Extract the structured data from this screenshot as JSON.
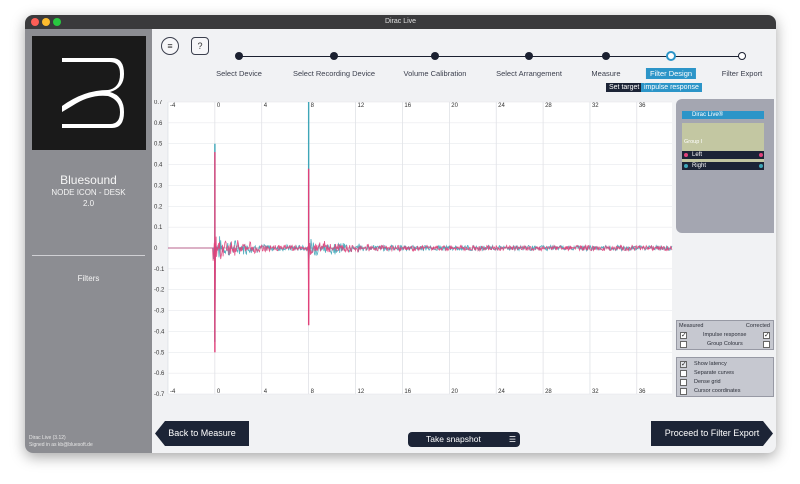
{
  "window": {
    "title": "Dirac Live"
  },
  "device": {
    "brand": "Bluesound",
    "model": "NODE ICON - DESK",
    "version": "2.0",
    "section": "Filters"
  },
  "footer": {
    "version": "Dirac Live (3.12)",
    "signed_in": "Signed in as kb@bluesoft.de"
  },
  "header": {
    "menu_icon": "hamburger-icon",
    "help_label": "?"
  },
  "steps": [
    {
      "label": "Select Device",
      "state": "done"
    },
    {
      "label": "Select Recording Device",
      "state": "done"
    },
    {
      "label": "Volume Calibration",
      "state": "done"
    },
    {
      "label": "Select Arrangement",
      "state": "done"
    },
    {
      "label": "Measure",
      "state": "done"
    },
    {
      "label": "Filter Design",
      "state": "active"
    },
    {
      "label": "Filter Export",
      "state": "pending"
    }
  ],
  "tabs": {
    "target": "Set target",
    "impulse": "impulse response"
  },
  "right_panel": {
    "group_title": "Dirac Live®",
    "group_label": "Group I",
    "channels": [
      {
        "name": "Left",
        "color": "#e0417a"
      },
      {
        "name": "Right",
        "color": "#3fa6b8"
      }
    ]
  },
  "options": {
    "measured": "Measured",
    "corrected": "Corrected",
    "impulse": "Impulse response",
    "group_colours": "Group Colours",
    "show_latency": "Show latency",
    "separate_curves": "Separate curves",
    "dense_grid": "Dense grid",
    "cursor_coordinates": "Cursor coordinates"
  },
  "buttons": {
    "back": "Back to Measure",
    "proceed": "Proceed to Filter Export",
    "snapshot": "Take snapshot"
  },
  "chart_data": {
    "type": "line",
    "x_ticks": [
      "-4",
      "0",
      "4",
      "8",
      "12",
      "16",
      "20",
      "24",
      "28",
      "32",
      "36"
    ],
    "y_ticks": [
      "0.7",
      "0.6",
      "0.5",
      "0.4",
      "0.3",
      "0.2",
      "0.1",
      "0",
      "-0.1",
      "-0.2",
      "-0.3",
      "-0.4",
      "-0.5",
      "-0.6",
      "-0.7"
    ],
    "xlim": [
      -4,
      39
    ],
    "ylim": [
      -0.7,
      0.7
    ],
    "series": [
      {
        "color": "#3fa6b8",
        "peaks": [
          {
            "x": 0,
            "y": 0.5
          },
          {
            "x": 0,
            "y": -0.45
          },
          {
            "x": 8,
            "y": 0.7
          },
          {
            "x": 8,
            "y": -0.1
          }
        ]
      },
      {
        "color": "#e0417a",
        "peaks": [
          {
            "x": 0,
            "y": 0.46
          },
          {
            "x": 0,
            "y": -0.5
          },
          {
            "x": 8,
            "y": 0.38
          },
          {
            "x": 8,
            "y": -0.37
          }
        ]
      }
    ]
  }
}
